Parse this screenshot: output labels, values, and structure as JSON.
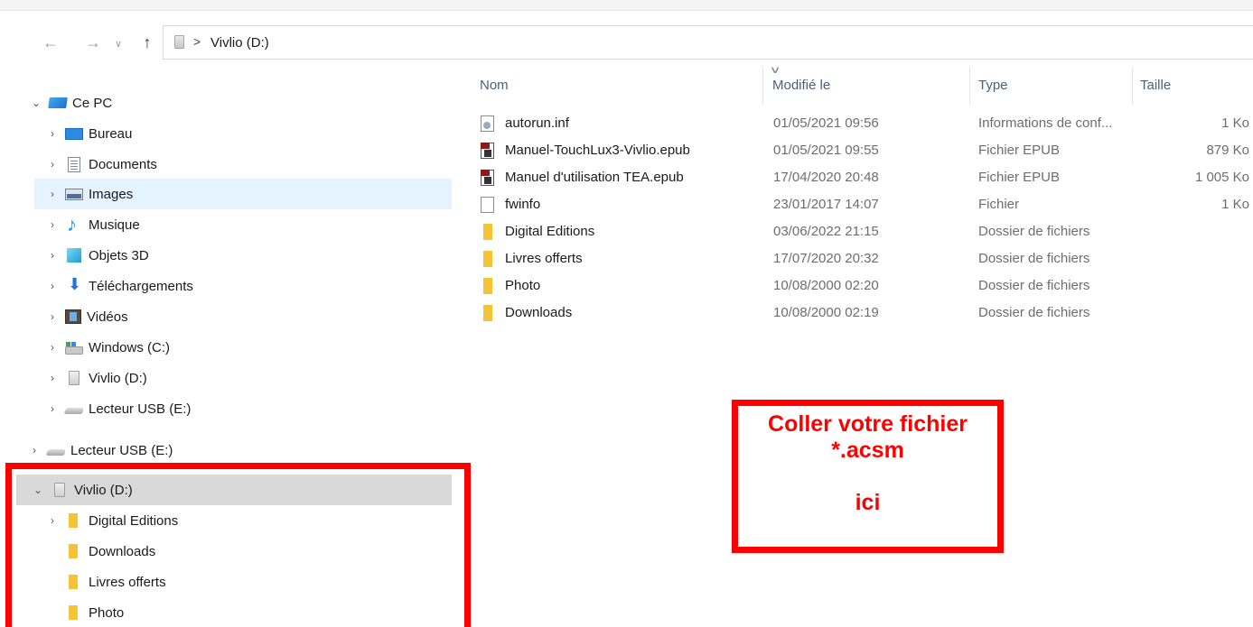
{
  "address": {
    "crumb": "Vivlio (D:)",
    "separator": ">"
  },
  "navigation": {
    "back_icon": "←",
    "forward_icon": "→",
    "recent_icon": "∨",
    "up_icon": "↑"
  },
  "tree": {
    "this_pc": "Ce PC",
    "items": [
      {
        "label": "Bureau",
        "icon": "desktop-icon"
      },
      {
        "label": "Documents",
        "icon": "documents-icon"
      },
      {
        "label": "Images",
        "icon": "pictures-icon"
      },
      {
        "label": "Musique",
        "icon": "music-icon"
      },
      {
        "label": "Objets 3D",
        "icon": "3d-objects-icon"
      },
      {
        "label": "Téléchargements",
        "icon": "downloads-icon"
      },
      {
        "label": "Vidéos",
        "icon": "videos-icon"
      },
      {
        "label": "Windows (C:)",
        "icon": "windows-drive-icon"
      },
      {
        "label": "Vivlio (D:)",
        "icon": "drive-icon"
      },
      {
        "label": "Lecteur USB (E:)",
        "icon": "usb-drive-icon"
      }
    ],
    "usb_root": "Lecteur USB (E:)",
    "vivlio_root": "Vivlio (D:)",
    "vivlio_children": [
      "Digital Editions",
      "Downloads",
      "Livres offerts",
      "Photo"
    ]
  },
  "columns": {
    "name": "Nom",
    "modified": "Modifié le",
    "type": "Type",
    "size": "Taille"
  },
  "files": [
    {
      "name": "autorun.inf",
      "modified": "01/05/2021 09:56",
      "type": "Informations de conf...",
      "size": "1 Ko",
      "icon": "inf"
    },
    {
      "name": "Manuel-TouchLux3-Vivlio.epub",
      "modified": "01/05/2021 09:55",
      "type": "Fichier EPUB",
      "size": "879 Ko",
      "icon": "epub"
    },
    {
      "name": "Manuel d'utilisation TEA.epub",
      "modified": "17/04/2020 20:48",
      "type": "Fichier EPUB",
      "size": "1 005 Ko",
      "icon": "epub"
    },
    {
      "name": "fwinfo",
      "modified": "23/01/2017 14:07",
      "type": "Fichier",
      "size": "1 Ko",
      "icon": "plain"
    },
    {
      "name": "Digital Editions",
      "modified": "03/06/2022 21:15",
      "type": "Dossier de fichiers",
      "size": "",
      "icon": "folder"
    },
    {
      "name": "Livres offerts",
      "modified": "17/07/2020 20:32",
      "type": "Dossier de fichiers",
      "size": "",
      "icon": "folder"
    },
    {
      "name": "Photo",
      "modified": "10/08/2000 02:20",
      "type": "Dossier de fichiers",
      "size": "",
      "icon": "folder"
    },
    {
      "name": "Downloads",
      "modified": "10/08/2000 02:19",
      "type": "Dossier de fichiers",
      "size": "",
      "icon": "folder"
    }
  ],
  "callout": {
    "line1": "Coller votre fichier",
    "line2": "*.acsm",
    "line3": "",
    "line4": "ici"
  },
  "colors": {
    "annotation_red": "#ff0000",
    "selection_blue": "#e5f3ff",
    "selection_gray": "#d9d9d9",
    "folder_yellow": "#f5c336"
  }
}
